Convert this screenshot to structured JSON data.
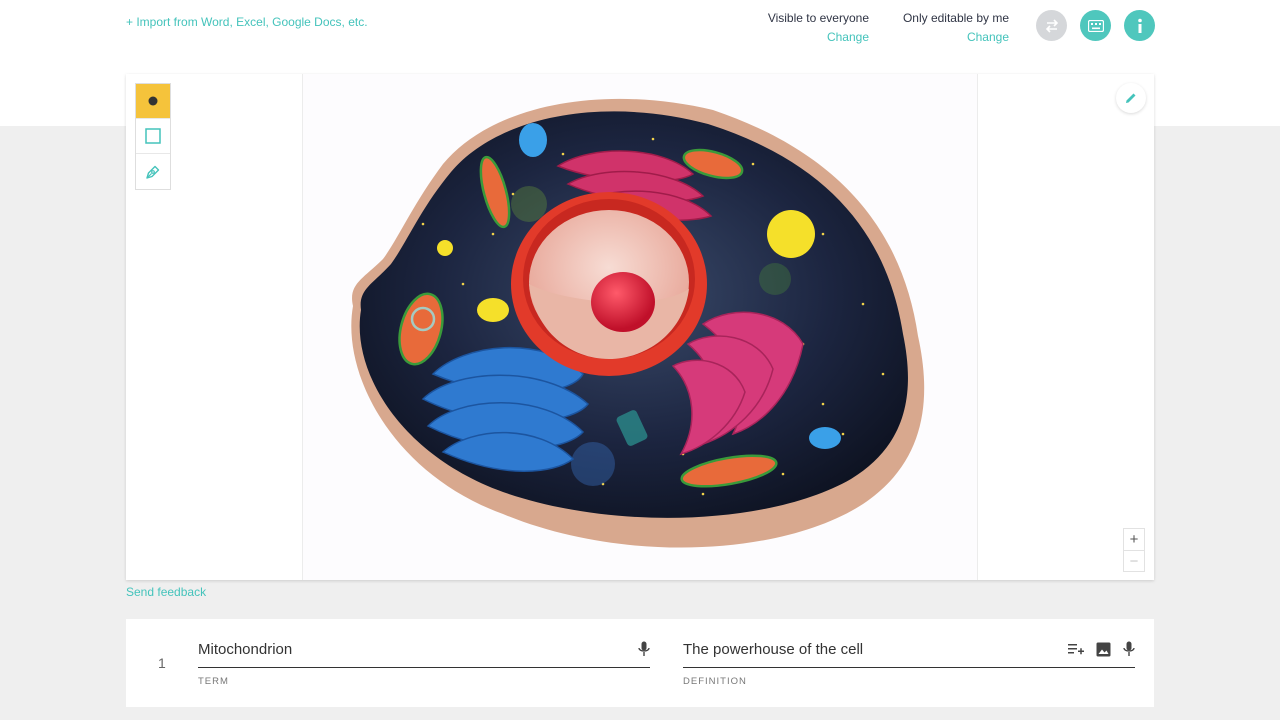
{
  "header": {
    "import_link": "+ Import from Word, Excel, Google Docs, etc.",
    "visibility": {
      "label": "Visible to everyone",
      "action": "Change"
    },
    "editability": {
      "label": "Only editable by me",
      "action": "Change"
    },
    "accent_color": "#44c3bb"
  },
  "editor": {
    "tools": [
      {
        "name": "point",
        "icon": "dot-icon",
        "active": true
      },
      {
        "name": "rectangle",
        "icon": "square-icon",
        "active": false
      },
      {
        "name": "pen",
        "icon": "pen-icon",
        "active": false
      }
    ],
    "zoom": {
      "in": "+",
      "out": "−"
    },
    "image": {
      "subject": "animal-cell-diagram"
    }
  },
  "feedback_link": "Send feedback",
  "cards": [
    {
      "number": "1",
      "term": "Mitochondrion",
      "term_label": "TERM",
      "definition": "The powerhouse of the cell",
      "definition_label": "DEFINITION"
    }
  ]
}
